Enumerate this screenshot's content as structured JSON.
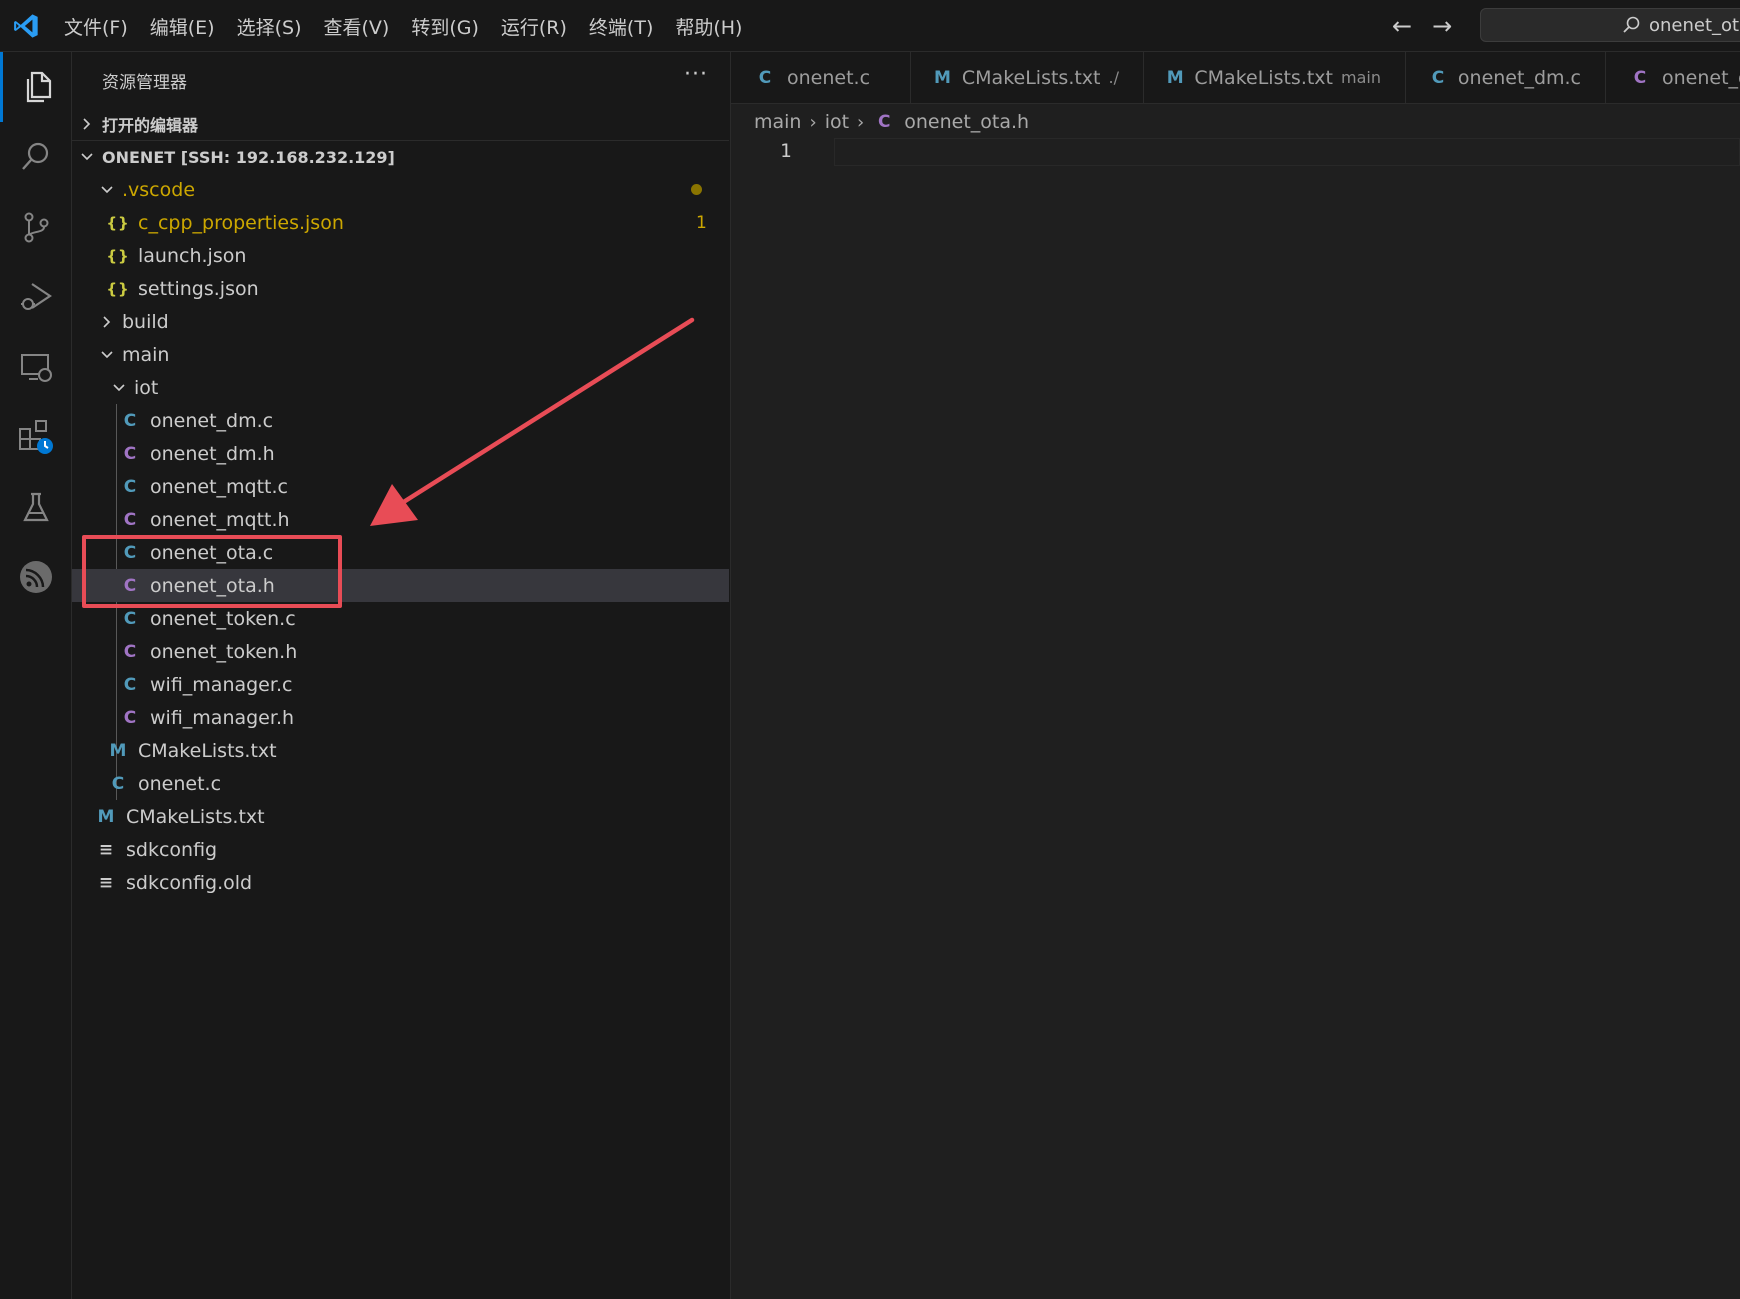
{
  "menu": {
    "items": [
      "文件(F)",
      "编辑(E)",
      "选择(S)",
      "查看(V)",
      "转到(G)",
      "运行(R)",
      "终端(T)",
      "帮助(H)"
    ]
  },
  "command_center": {
    "text": "onenet_ota.h"
  },
  "explorer": {
    "title": "资源管理器",
    "more": "···",
    "open_editors_label": "打开的编辑器",
    "workspace_label": "ONENET [SSH: 192.168.232.129]",
    "tree": {
      "vscode": ".vscode",
      "c_cpp_properties": "c_cpp_properties.json",
      "c_cpp_badge": "1",
      "launch": "launch.json",
      "settings": "settings.json",
      "build": "build",
      "main": "main",
      "iot": "iot",
      "onenet_dm_c": "onenet_dm.c",
      "onenet_dm_h": "onenet_dm.h",
      "onenet_mqtt_c": "onenet_mqtt.c",
      "onenet_mqtt_h": "onenet_mqtt.h",
      "onenet_ota_c": "onenet_ota.c",
      "onenet_ota_h": "onenet_ota.h",
      "onenet_token_c": "onenet_token.c",
      "onenet_token_h": "onenet_token.h",
      "wifi_manager_c": "wifi_manager.c",
      "wifi_manager_h": "wifi_manager.h",
      "main_cmakelists": "CMakeLists.txt",
      "onenet_c": "onenet.c",
      "root_cmakelists": "CMakeLists.txt",
      "sdkconfig": "sdkconfig",
      "sdkconfig_old": "sdkconfig.old"
    },
    "icon_letters": {
      "c": "C",
      "m": "M",
      "json": "{}",
      "lines": "≡"
    }
  },
  "tabs": [
    {
      "icon": "C",
      "label": "onenet.c",
      "desc": ""
    },
    {
      "icon": "M",
      "label": "CMakeLists.txt",
      "desc": "./"
    },
    {
      "icon": "M",
      "label": "CMakeLists.txt",
      "desc": "main"
    },
    {
      "icon": "C",
      "label": "onenet_dm.c",
      "desc": ""
    },
    {
      "icon": "C",
      "label": "onenet_dr",
      "desc": ""
    }
  ],
  "breadcrumb": {
    "part1": "main",
    "part2": "iot",
    "icon": "C",
    "file": "onenet_ota.h"
  },
  "editor": {
    "line_number": "1"
  },
  "colors": {
    "c_file": "#519aba",
    "h_file": "#a074c4",
    "json_file": "#cbcb41",
    "warning": "#cca700",
    "annotation": "#e84c56",
    "accent": "#0078d4"
  }
}
